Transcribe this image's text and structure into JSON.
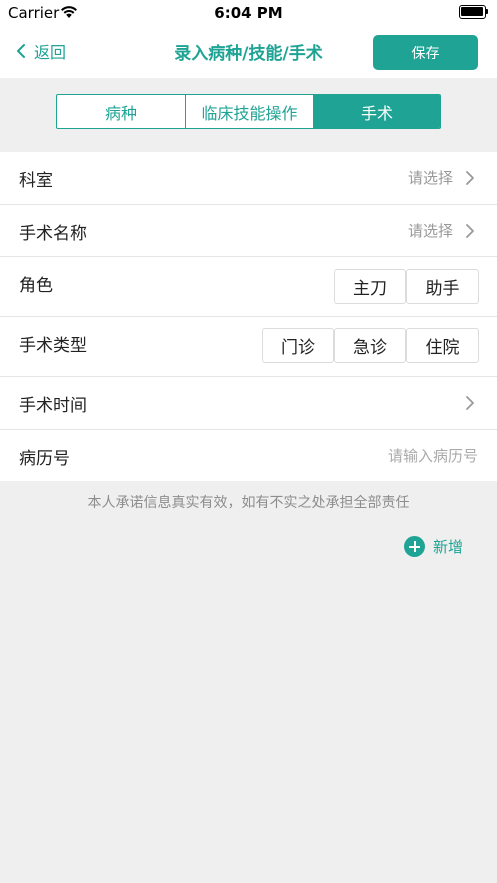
{
  "status_bar": {
    "carrier": "Carrier",
    "time": "6:04 PM"
  },
  "nav": {
    "back_label": "返回",
    "title": "录入病种/技能/手术",
    "save_label": "保存"
  },
  "tabs": [
    {
      "label": "病种",
      "active": false
    },
    {
      "label": "临床技能操作",
      "active": false
    },
    {
      "label": "手术",
      "active": true
    }
  ],
  "form": {
    "department": {
      "label": "科室",
      "value": "请选择"
    },
    "surgery_name": {
      "label": "手术名称",
      "value": "请选择"
    },
    "role": {
      "label": "角色",
      "options": [
        "主刀",
        "助手"
      ]
    },
    "surgery_type": {
      "label": "手术类型",
      "options": [
        "门诊",
        "急诊",
        "住院"
      ]
    },
    "surgery_time": {
      "label": "手术时间",
      "value": ""
    },
    "record_number": {
      "label": "病历号",
      "placeholder": "请输入病历号"
    }
  },
  "disclaimer": "本人承诺信息真实有效，如有不实之处承担全部责任",
  "add_label": "新增",
  "colors": {
    "accent": "#1fa394",
    "background": "#efefef",
    "placeholder": "#999999"
  },
  "icons": [
    "wifi-icon",
    "battery-icon",
    "chevron-left-icon",
    "chevron-right-icon",
    "plus-circle-icon"
  ]
}
